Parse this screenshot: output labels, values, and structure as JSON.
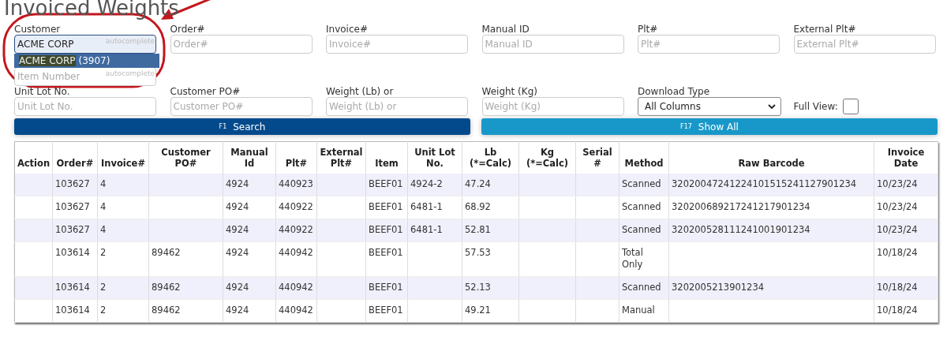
{
  "title": "Invoiced Weights",
  "form": {
    "rows": [
      [
        {
          "kind": "text",
          "label": "Customer",
          "value": "ACME CORP",
          "hint": "autocomplete",
          "focused": true
        },
        {
          "kind": "text",
          "label": "Order#",
          "placeholder": "Order#"
        },
        {
          "kind": "text",
          "label": "Invoice#",
          "placeholder": "Invoice#"
        },
        {
          "kind": "text",
          "label": "Manual ID",
          "placeholder": "Manual ID"
        },
        {
          "kind": "text",
          "label": "Plt#",
          "placeholder": "Plt#"
        },
        {
          "kind": "text",
          "label": "External Plt#",
          "placeholder": "External Plt#"
        }
      ],
      [
        {
          "kind": "text",
          "placeholder": "Item Number",
          "hint": "autocomplete"
        }
      ],
      [
        {
          "kind": "text",
          "label": "Unit Lot No.",
          "placeholder": "Unit Lot No."
        },
        {
          "kind": "text",
          "label": "Customer PO#",
          "placeholder": "Customer PO#"
        },
        {
          "kind": "text",
          "label": "Weight (Lb) or",
          "placeholder": "Weight (Lb) or"
        },
        {
          "kind": "text",
          "label": "Weight (Kg)",
          "placeholder": "Weight (Kg)"
        },
        {
          "kind": "select",
          "label": "Download Type",
          "value": "All Columns"
        },
        {
          "kind": "checkbox",
          "label": "Full View:",
          "checked": false
        }
      ]
    ],
    "suggestion": {
      "match": "ACME CORP",
      "rest": "(3907)"
    }
  },
  "buttons": [
    {
      "kind": "primary",
      "key": "F1",
      "label": "Search"
    },
    {
      "kind": "secondary",
      "key": "F17",
      "label": "Show All"
    }
  ],
  "table": {
    "columns": [
      "Action",
      "Order#",
      "Invoice#",
      "Customer PO#",
      "Manual Id",
      "Plt#",
      "External Plt#",
      "Item",
      "Unit Lot No.",
      "Lb (*=Calc)",
      "Kg (*=Calc)",
      "Serial #",
      "Method",
      "Raw Barcode",
      "Invoice Date"
    ],
    "rows": [
      [
        "",
        "103627",
        "4",
        "",
        "4924",
        "440923",
        "",
        "BEEF01",
        "4924-2",
        "47.24",
        "",
        "",
        "Scanned",
        "32020047241224101515241127901234",
        "10/23/24"
      ],
      [
        "",
        "103627",
        "4",
        "",
        "4924",
        "440922",
        "",
        "BEEF01",
        "6481-1",
        "68.92",
        "",
        "",
        "Scanned",
        "320200689217241217901234",
        "10/23/24"
      ],
      [
        "",
        "103627",
        "4",
        "",
        "4924",
        "440922",
        "",
        "BEEF01",
        "6481-1",
        "52.81",
        "",
        "",
        "Scanned",
        "320200528111241001901234",
        "10/23/24"
      ],
      [
        "",
        "103614",
        "2",
        "89462",
        "4924",
        "440942",
        "",
        "BEEF01",
        "",
        "57.53",
        "",
        "",
        "Total Only",
        "",
        "10/18/24"
      ],
      [
        "",
        "103614",
        "2",
        "89462",
        "4924",
        "440942",
        "",
        "BEEF01",
        "",
        "52.13",
        "",
        "",
        "Scanned",
        "3202005213901234",
        "10/18/24"
      ],
      [
        "",
        "103614",
        "2",
        "89462",
        "4924",
        "440942",
        "",
        "BEEF01",
        "",
        "49.21",
        "",
        "",
        "Manual",
        "",
        "10/18/24"
      ]
    ]
  }
}
